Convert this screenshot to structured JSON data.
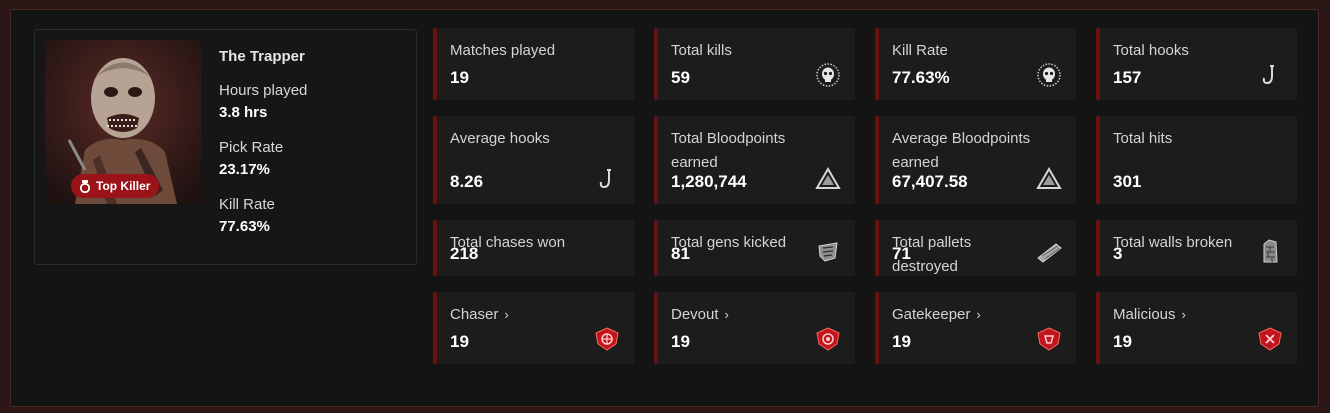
{
  "killer": {
    "name": "The Trapper",
    "badge_label": "Top Killer",
    "stats": [
      {
        "label": "Hours played",
        "value": "3.8 hrs"
      },
      {
        "label": "Pick Rate",
        "value": "23.17%"
      },
      {
        "label": "Kill Rate",
        "value": "77.63%"
      }
    ]
  },
  "cards": [
    {
      "title": "Matches played",
      "value": "19",
      "icon": ""
    },
    {
      "title": "Total kills",
      "value": "59",
      "icon": "skull-icon"
    },
    {
      "title": "Kill Rate",
      "value": "77.63%",
      "icon": "skull-icon"
    },
    {
      "title": "Total hooks",
      "value": "157",
      "icon": "hook-icon"
    },
    {
      "title": "Average hooks",
      "value": "8.26",
      "icon": "hook-icon"
    },
    {
      "title": "Total Bloodpoints earned",
      "value": "1,280,744",
      "icon": "bloodpoints-icon"
    },
    {
      "title": "Average Bloodpoints earned",
      "value": "67,407.58",
      "icon": "bloodpoints-icon"
    },
    {
      "title": "Total hits",
      "value": "301",
      "icon": ""
    },
    {
      "title": "Total chases won",
      "value": "218",
      "icon": ""
    },
    {
      "title": "Total gens kicked",
      "value": "81",
      "icon": "generator-icon"
    },
    {
      "title": "Total pallets destroyed",
      "value": "71",
      "icon": "pallet-icon"
    },
    {
      "title": "Total walls broken",
      "value": "3",
      "icon": "wall-icon"
    },
    {
      "title": "Chaser",
      "value": "19",
      "icon": "emblem-chaser-icon",
      "link": true
    },
    {
      "title": "Devout",
      "value": "19",
      "icon": "emblem-devout-icon",
      "link": true
    },
    {
      "title": "Gatekeeper",
      "value": "19",
      "icon": "emblem-gatekeeper-icon",
      "link": true
    },
    {
      "title": "Malicious",
      "value": "19",
      "icon": "emblem-malicious-icon",
      "link": true
    }
  ],
  "link_chevron": "›",
  "colors": {
    "accent": "#6b1010",
    "badge": "#9c1219",
    "card_bg": "#1c1c1c",
    "emblem": "#c0141e"
  }
}
